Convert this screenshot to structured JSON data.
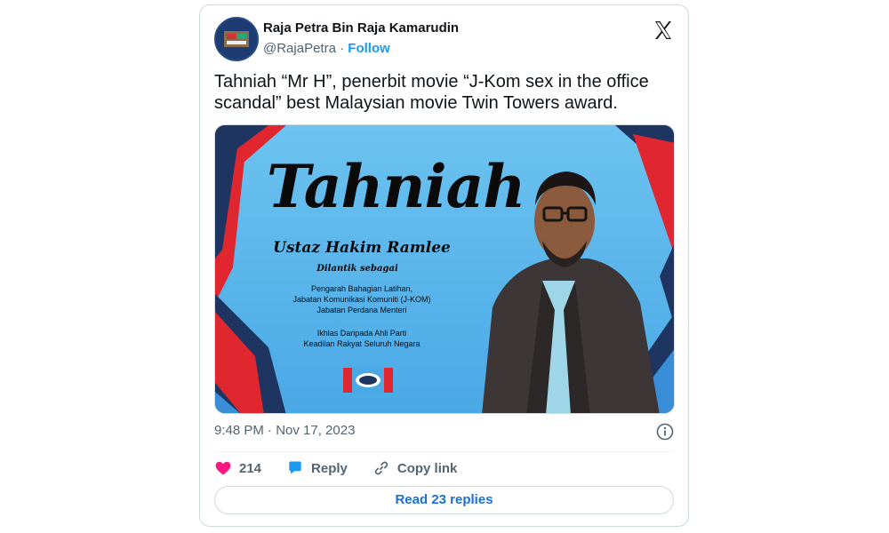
{
  "author": {
    "name": "Raja Petra Bin Raja Kamarudin",
    "handle": "@RajaPetra",
    "separator": "·",
    "follow_label": "Follow"
  },
  "tweet": {
    "text": "Tahniah “Mr H”, penerbit movie “J-Kom sex in the office scandal” best Malaysian movie Twin Towers award.",
    "timestamp": "9:48 PM · Nov 17, 2023"
  },
  "flyer": {
    "title": "Tahniah",
    "name": "Ustaz Hakim Ramlee",
    "appointed": "Dilantik sebagai",
    "position_lines": [
      "Pengarah Bahagian Latihan,",
      "Jabatan Komunikasi Komuniti (J-KOM)",
      "Jabatan Perdana Menteri"
    ],
    "from_lines": [
      "Ikhlas Daripada Ahli Parti",
      "Keadilan Rakyat Seluruh Negara"
    ]
  },
  "actions": {
    "like_count": "214",
    "reply_label": "Reply",
    "copy_label": "Copy link"
  },
  "read_replies_label": "Read 23 replies",
  "colors": {
    "link": "#1d9bf0",
    "like": "#f91880",
    "reply": "#1d9bf0"
  }
}
